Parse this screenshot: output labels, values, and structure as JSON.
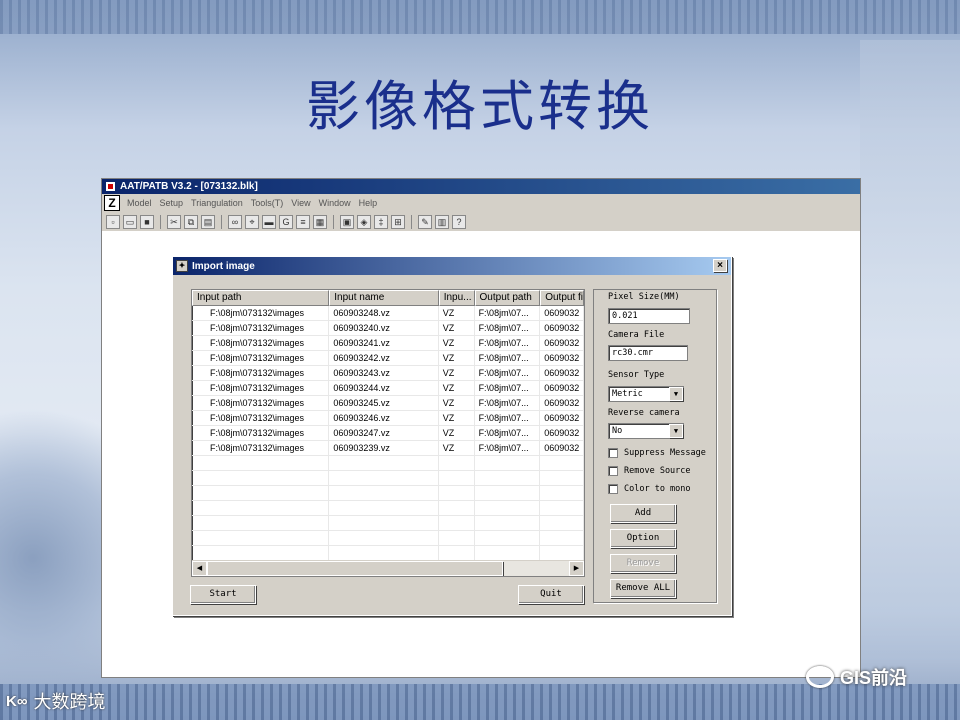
{
  "slide": {
    "title": "影像格式转换"
  },
  "app": {
    "title": "AAT/PATB V3.2 - [073132.blk]",
    "menu": [
      "Model",
      "Setup",
      "Triangulation",
      "Tools(T)",
      "View",
      "Window",
      "Help"
    ],
    "toolbar_icons": [
      "new-file-icon",
      "open-folder-icon",
      "save-icon",
      "cut-icon",
      "copy-icon",
      "paste-icon",
      "tool-icon-1",
      "tool-icon-2",
      "tool-icon-3",
      "gx-icon",
      "tool-icon-4",
      "tool-icon-5",
      "window-icon",
      "ccd-icon",
      "tool-icon-6",
      "tool-icon-7",
      "edit-icon",
      "book-icon",
      "help-icon"
    ]
  },
  "dialog": {
    "title": "Import image",
    "close": "×",
    "columns": [
      "Input path",
      "Input name",
      "Inpu...",
      "Output path",
      "Output fil"
    ],
    "rows": [
      [
        "F:\\08jm\\073132\\images",
        "060903248.vz",
        "VZ",
        "F:\\08jm\\07...",
        "0609032"
      ],
      [
        "F:\\08jm\\073132\\images",
        "060903240.vz",
        "VZ",
        "F:\\08jm\\07...",
        "0609032"
      ],
      [
        "F:\\08jm\\073132\\images",
        "060903241.vz",
        "VZ",
        "F:\\08jm\\07...",
        "0609032"
      ],
      [
        "F:\\08jm\\073132\\images",
        "060903242.vz",
        "VZ",
        "F:\\08jm\\07...",
        "0609032"
      ],
      [
        "F:\\08jm\\073132\\images",
        "060903243.vz",
        "VZ",
        "F:\\08jm\\07...",
        "0609032"
      ],
      [
        "F:\\08jm\\073132\\images",
        "060903244.vz",
        "VZ",
        "F:\\08jm\\07...",
        "0609032"
      ],
      [
        "F:\\08jm\\073132\\images",
        "060903245.vz",
        "VZ",
        "F:\\08jm\\07...",
        "0609032"
      ],
      [
        "F:\\08jm\\073132\\images",
        "060903246.vz",
        "VZ",
        "F:\\08jm\\07...",
        "0609032"
      ],
      [
        "F:\\08jm\\073132\\images",
        "060903247.vz",
        "VZ",
        "F:\\08jm\\07...",
        "0609032"
      ],
      [
        "F:\\08jm\\073132\\images",
        "060903239.vz",
        "VZ",
        "F:\\08jm\\07...",
        "0609032"
      ]
    ],
    "start_label": "Start",
    "quit_label": "Quit",
    "panel": {
      "pixel_size_label": "Pixel Size(MM)",
      "pixel_size_value": "0.021",
      "camera_file_label": "Camera File",
      "camera_file_value": "rc30.cmr",
      "sensor_type_label": "Sensor Type",
      "sensor_type_value": "Metric",
      "reverse_camera_label": "Reverse camera",
      "reverse_camera_value": "No",
      "suppress_message_label": "Suppress Message",
      "remove_source_label": "Remove Source",
      "color_to_mono_label": "Color to mono",
      "add_label": "Add",
      "option_label": "Option",
      "remove_label": "Remove",
      "remove_all_label": "Remove ALL"
    }
  },
  "watermark": {
    "text": "GIS前沿"
  },
  "logo": {
    "text": "大数跨境"
  }
}
